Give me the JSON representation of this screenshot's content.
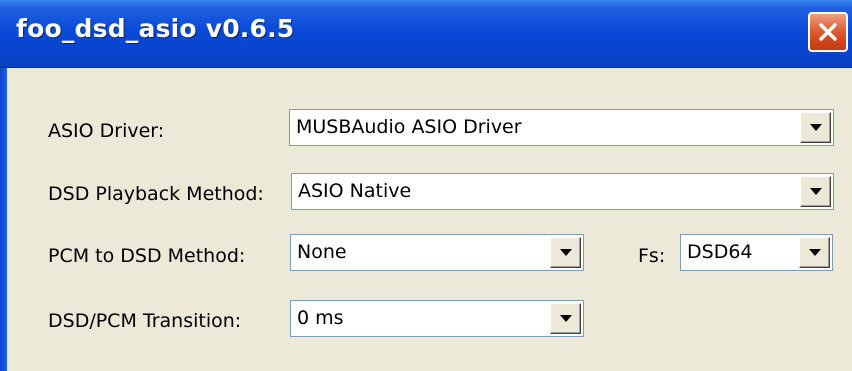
{
  "window": {
    "title": "foo_dsd_asio v0.6.5"
  },
  "form": {
    "asio_driver": {
      "label": "ASIO Driver:",
      "value": "MUSBAudio ASIO Driver"
    },
    "dsd_playback_method": {
      "label": "DSD Playback Method:",
      "value": "ASIO Native"
    },
    "pcm_to_dsd_method": {
      "label": "PCM to DSD Method:",
      "value": "None"
    },
    "fs": {
      "label": "Fs:",
      "value": "DSD64"
    },
    "dsd_pcm_transition": {
      "label": "DSD/PCM Transition:",
      "value": "0 ms"
    }
  },
  "icons": {
    "close": "close-icon",
    "dropdown": "chevron-down-icon"
  },
  "colors": {
    "titlebar": "#0a4ad8",
    "close_button": "#d2491d",
    "dialog_background": "#ece9d8"
  }
}
